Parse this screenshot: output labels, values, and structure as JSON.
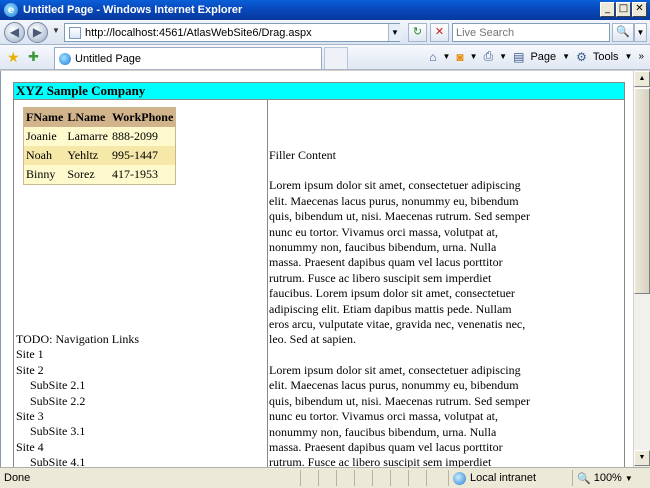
{
  "window": {
    "title": "Untitled Page - Windows Internet Explorer",
    "min": "_",
    "max": "□",
    "close": "✕"
  },
  "nav": {
    "back_glyph": "◀",
    "forward_glyph": "▶",
    "address": "http://localhost:4561/AtlasWebSite6/Drag.aspx",
    "search_placeholder": "Live Search",
    "refresh_glyph": "↻",
    "stop_glyph": "✕",
    "search_glyph": "🔍"
  },
  "tabs": [
    {
      "label": "Untitled Page"
    }
  ],
  "commands": {
    "page": "Page",
    "tools": "Tools"
  },
  "page": {
    "header": "XYZ Sample Company",
    "table": {
      "columns": [
        "FName",
        "LName",
        "WorkPhone"
      ],
      "rows": [
        [
          "Joanie",
          "Lamarre",
          "888-2099"
        ],
        [
          "Noah",
          "Yehltz",
          "995-1447"
        ],
        [
          "Binny",
          "Sorez",
          "417-1953"
        ]
      ]
    },
    "nav_title": "TODO: Navigation Links",
    "nav_links": [
      {
        "label": "Site 1",
        "level": 0
      },
      {
        "label": "Site 2",
        "level": 0
      },
      {
        "label": "SubSite 2.1",
        "level": 1
      },
      {
        "label": "SubSite 2.2",
        "level": 1
      },
      {
        "label": "Site 3",
        "level": 0
      },
      {
        "label": "SubSite 3.1",
        "level": 1
      },
      {
        "label": "Site 4",
        "level": 0
      },
      {
        "label": "SubSite 4.1",
        "level": 1
      }
    ],
    "filler_title": "Filler Content",
    "paragraphs": [
      "Lorem ipsum dolor sit amet, consectetuer adipiscing elit. Maecenas lacus purus, nonummy eu, bibendum quis, bibendum ut, nisi. Maecenas rutrum. Sed semper nunc eu tortor. Vivamus orci massa, volutpat at, nonummy non, faucibus bibendum, urna. Nulla massa. Praesent dapibus quam vel lacus porttitor rutrum. Fusce ac libero suscipit sem imperdiet faucibus. Lorem ipsum dolor sit amet, consectetuer adipiscing elit. Etiam dapibus mattis pede. Nullam eros arcu, vulputate vitae, gravida nec, venenatis nec, leo. Sed at sapien.",
      "Lorem ipsum dolor sit amet, consectetuer adipiscing elit. Maecenas lacus purus, nonummy eu, bibendum quis, bibendum ut, nisi. Maecenas rutrum. Sed semper nunc eu tortor. Vivamus orci massa, volutpat at, nonummy non, faucibus bibendum, urna. Nulla massa. Praesent dapibus quam vel lacus porttitor rutrum. Fusce ac libero suscipit sem imperdiet faucibus."
    ]
  },
  "status": {
    "text": "Done",
    "zone": "Local intranet",
    "zoom": "100%"
  },
  "colors": {
    "header_bg": "#00ffff",
    "table_header_bg": "#d2b48c",
    "table_row_bg": "#fffacd",
    "table_alt_bg": "#f5e8a8"
  }
}
